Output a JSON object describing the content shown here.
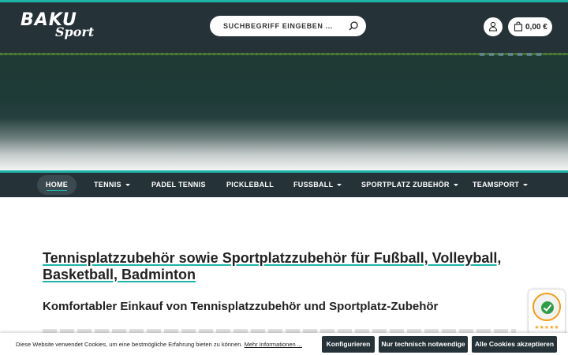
{
  "header": {
    "logo_line1": "BAKU",
    "logo_line2": "Sport",
    "search_placeholder": "SUCHBEGRIFF EINGEBEN ...",
    "cart_total": "0,00 €"
  },
  "nav": {
    "items": [
      {
        "label": "HOME",
        "dropdown": false,
        "active": true
      },
      {
        "label": "TENNIS",
        "dropdown": true
      },
      {
        "label": "PADEL TENNIS",
        "dropdown": false
      },
      {
        "label": "PICKLEBALL",
        "dropdown": false
      },
      {
        "label": "FUSSBALL",
        "dropdown": true
      },
      {
        "label": "SPORTPLATZ ZUBEHÖR",
        "dropdown": true
      },
      {
        "label": "TEAMSPORT",
        "dropdown": true
      }
    ]
  },
  "main": {
    "heading": "Tennisplatzzubehör sowie Sportplatzzubehör für Fußball, Volleyball, Basketball, Badminton",
    "subheading": "Komfortabler Einkauf von Tennisplatzzubehör und Sportplatz-Zubehör"
  },
  "trust_badge": {
    "stars": "★★★★★",
    "colors": {
      "ring": "#f39c12",
      "check": "#2e9e44"
    }
  },
  "cookie_bar": {
    "message": "Diese Website verwendet Cookies, um eine bestmögliche Erfahrung bieten zu können.",
    "more_link": "Mehr Informationen ...",
    "buttons": {
      "configure": "Konfigurieren",
      "technical_only": "Nur technisch notwendige",
      "accept_all": "Alle Cookies akzeptieren"
    }
  },
  "colors": {
    "dark": "#253238",
    "accent": "#1fb3a8"
  }
}
